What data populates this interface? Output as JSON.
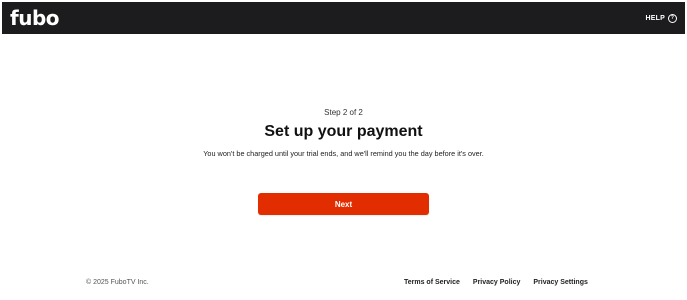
{
  "header": {
    "logo_text": "fubo",
    "help_label": "HELP",
    "help_icon": "question-circle-icon",
    "background": "#1c1c1e"
  },
  "main": {
    "step": "Step 2 of 2",
    "title": "Set up your payment",
    "subtitle": "You won't be charged until your trial ends, and we'll remind you the day before it's over.",
    "next_label": "Next",
    "accent": "#e12d00"
  },
  "footer": {
    "copyright": "© 2025 FuboTV Inc.",
    "links": [
      "Terms of Service",
      "Privacy Policy",
      "Privacy Settings"
    ]
  }
}
